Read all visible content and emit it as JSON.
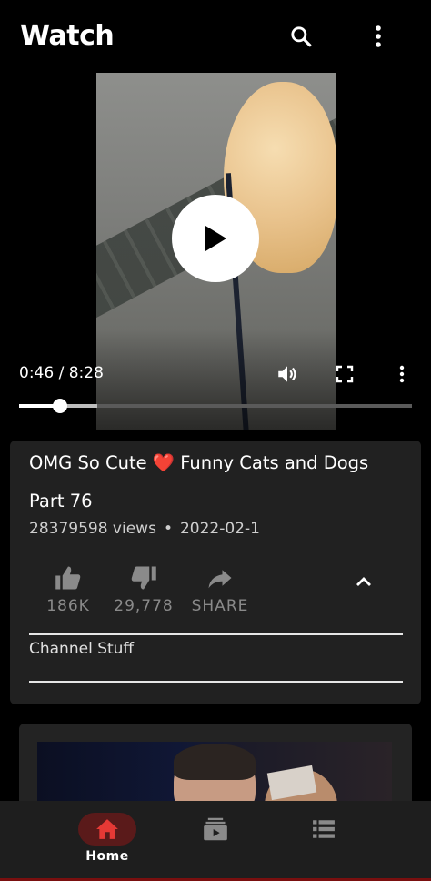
{
  "header": {
    "title": "Watch",
    "search_icon": "search-icon",
    "more_icon": "more-vert-icon"
  },
  "player": {
    "time": "0:46 / 8:28",
    "progress_fraction": 0.105,
    "buffer_fraction": 0.2,
    "controls": [
      "volume-icon",
      "fullscreen-icon",
      "more-vert-icon"
    ]
  },
  "video": {
    "title": "OMG So Cute ❤️ Funny Cats and Dogs Part 76",
    "views": "28379598 views",
    "separator": "•",
    "date": "2022-02-1",
    "like_count": "186K",
    "dislike_count": "29,778",
    "share_label": "SHARE",
    "channel_label": "Channel Stuff"
  },
  "nav": {
    "items": [
      {
        "label": "Home",
        "icon": "home-icon",
        "active": true
      },
      {
        "label": "",
        "icon": "subscriptions-icon",
        "active": false
      },
      {
        "label": "",
        "icon": "library-icon",
        "active": false
      }
    ]
  },
  "colors": {
    "background": "#000000",
    "card": "#212121",
    "accent": "#e53935",
    "nav_active_pill": "#5a1a1a"
  }
}
